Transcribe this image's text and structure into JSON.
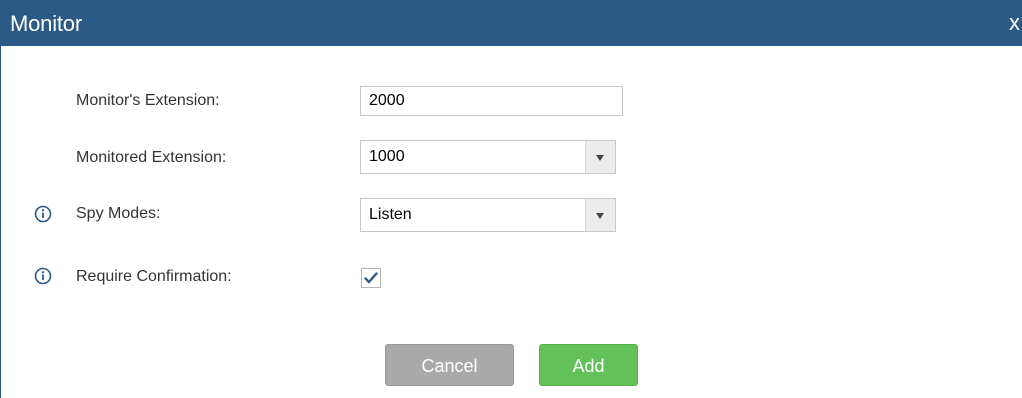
{
  "dialog": {
    "title": "Monitor",
    "close_label": "x"
  },
  "form": {
    "monitors_extension": {
      "label": "Monitor's Extension:",
      "value": "2000"
    },
    "monitored_extension": {
      "label": "Monitored Extension:",
      "selected": "1000"
    },
    "spy_modes": {
      "label": "Spy Modes:",
      "selected": "Listen",
      "has_info_icon": true
    },
    "require_confirmation": {
      "label": "Require Confirmation:",
      "checked": true,
      "has_info_icon": true
    }
  },
  "buttons": {
    "cancel_label": "Cancel",
    "add_label": "Add"
  },
  "colors": {
    "titlebar": "#2b5a87",
    "add_button": "#63c15a",
    "cancel_button": "#a9a9a9",
    "info_icon": "#2b5a87",
    "checkmark": "#2b5a87"
  },
  "icons": {
    "info": "info-circle-icon",
    "dropdown": "chevron-down-icon",
    "check": "checkmark-icon"
  }
}
